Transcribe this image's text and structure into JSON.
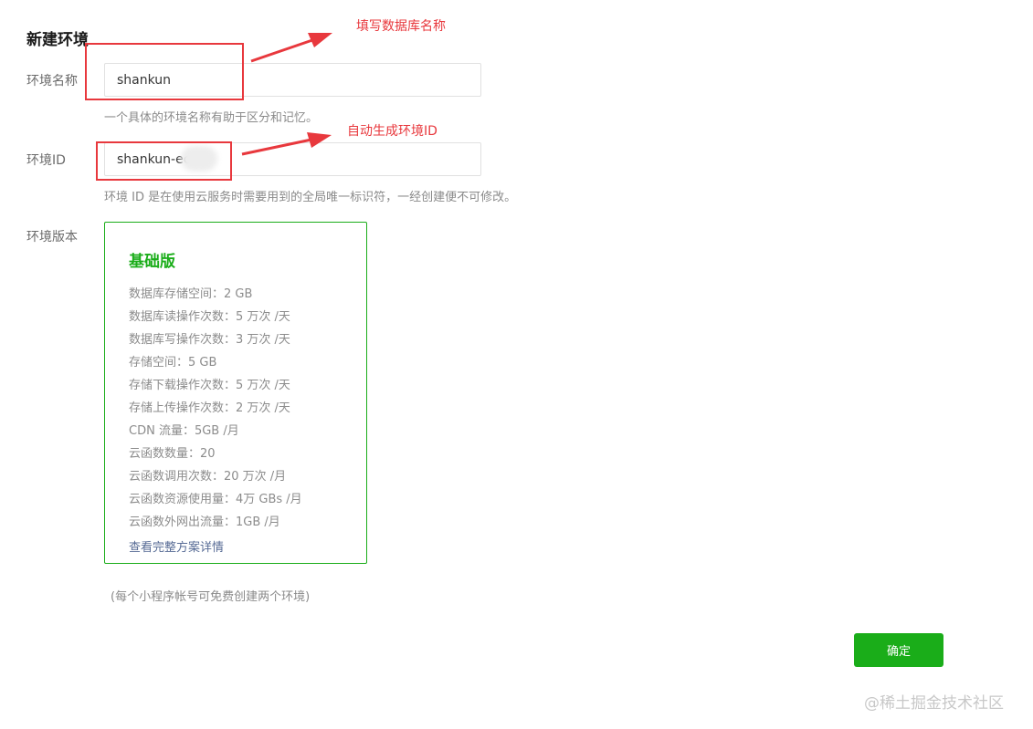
{
  "dialog": {
    "title": "新建环境"
  },
  "form": {
    "env_name": {
      "label": "环境名称",
      "value": "shankun",
      "hint": "一个具体的环境名称有助于区分和记忆。"
    },
    "env_id": {
      "label": "环境ID",
      "value": "shankun-ec e",
      "hint": "环境 ID 是在使用云服务时需要用到的全局唯一标识符，一经创建便不可修改。"
    },
    "env_version": {
      "label": "环境版本"
    }
  },
  "plan": {
    "name": "基础版",
    "quotas": [
      "数据库存储空间：2 GB",
      "数据库读操作次数：5 万次 /天",
      "数据库写操作次数：3 万次 /天",
      "存储空间：5 GB",
      "存储下载操作次数：5 万次 /天",
      "存储上传操作次数：2 万次 /天",
      "CDN 流量：5GB /月",
      "云函数数量：20",
      "云函数调用次数：20 万次 /月",
      "云函数资源使用量：4万 GBs /月",
      "云函数外网出流量：1GB /月"
    ],
    "details_link": "查看完整方案详情"
  },
  "note": "(每个小程序帐号可免费创建两个环境)",
  "buttons": {
    "confirm": "确定"
  },
  "annotations": {
    "name_callout": "填写数据库名称",
    "id_callout": "自动生成环境ID"
  },
  "watermark": "@稀土掘金技术社区",
  "colors": {
    "accent": "#1aad19",
    "link": "#576b95",
    "annotation": "#e8383d"
  }
}
